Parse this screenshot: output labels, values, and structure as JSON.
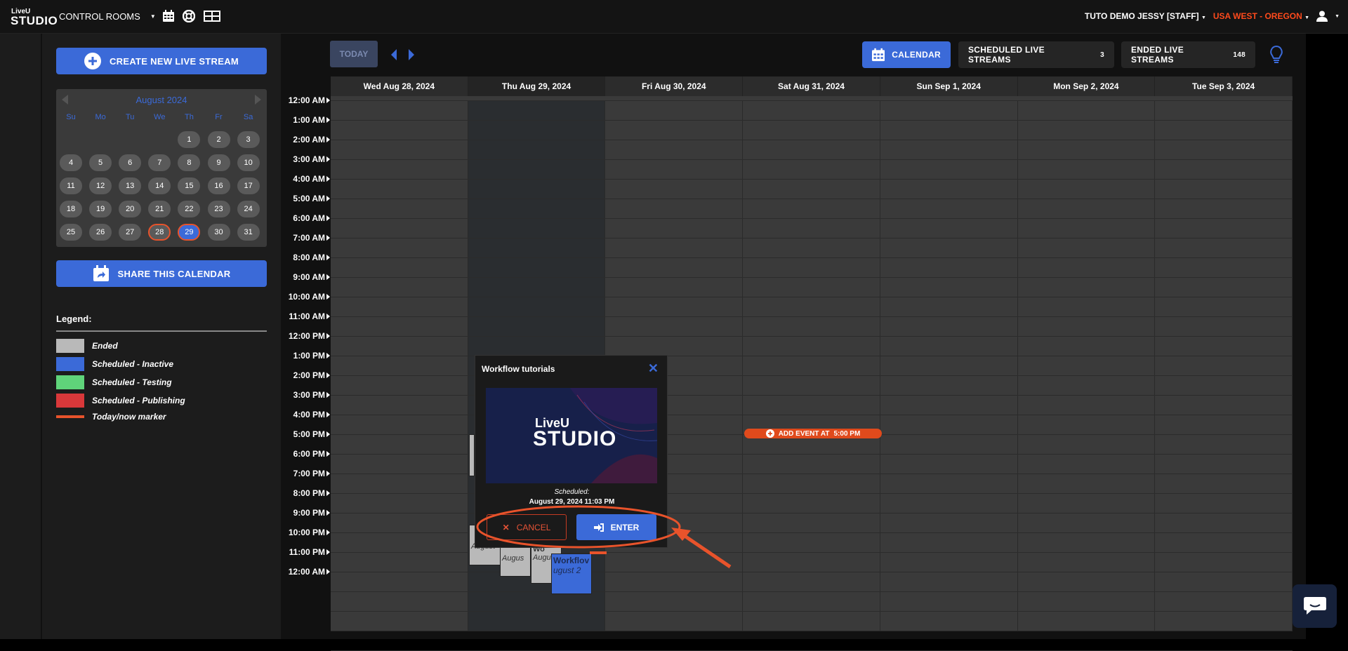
{
  "app": {
    "logo_top": "LiveU",
    "logo_bottom": "STUDIO"
  },
  "topbar": {
    "menu_label": "CONTROL ROOMS",
    "icons": [
      "calendar-icon",
      "lifebuoy-icon",
      "layout-icon"
    ],
    "user": "TUTO DEMO JESSY [STAFF]",
    "region": "USA WEST - OREGON",
    "colors": {
      "accent": "#3b6ad8",
      "region": "#ff4a1c"
    }
  },
  "sidebar": {
    "create_label": "CREATE NEW LIVE STREAM",
    "share_label": "SHARE THIS CALENDAR",
    "minical": {
      "month": "August 2024",
      "dows": [
        "Su",
        "Mo",
        "Tu",
        "We",
        "Th",
        "Fr",
        "Sa"
      ],
      "weeks": [
        [
          "",
          "",
          "",
          "",
          "1",
          "2",
          "3"
        ],
        [
          "4",
          "5",
          "6",
          "7",
          "8",
          "9",
          "10"
        ],
        [
          "11",
          "12",
          "13",
          "14",
          "15",
          "16",
          "17"
        ],
        [
          "18",
          "19",
          "20",
          "21",
          "22",
          "23",
          "24"
        ],
        [
          "25",
          "26",
          "27",
          "28",
          "29",
          "30",
          "31"
        ]
      ],
      "selected": "29",
      "marked": "28"
    },
    "legend": {
      "title": "Legend:",
      "items": [
        {
          "label": "Ended",
          "color": "#b9b9b9"
        },
        {
          "label": "Scheduled - Inactive",
          "color": "#3b6ad8"
        },
        {
          "label": "Scheduled - Testing",
          "color": "#5fd47a"
        },
        {
          "label": "Scheduled - Publishing",
          "color": "#d9383a"
        },
        {
          "label": "Today/now marker",
          "color": "#e8532b"
        }
      ]
    }
  },
  "toolbar": {
    "today_label": "TODAY",
    "calendar_label": "CALENDAR",
    "scheduled_label": "SCHEDULED LIVE STREAMS",
    "scheduled_count": "3",
    "ended_label": "ENDED LIVE STREAMS",
    "ended_count": "148"
  },
  "calendar": {
    "days": [
      "Wed Aug 28, 2024",
      "Thu Aug 29, 2024",
      "Fri Aug 30, 2024",
      "Sat Aug 31, 2024",
      "Sun Sep 1, 2024",
      "Mon Sep 2, 2024",
      "Tue Sep 3, 2024"
    ],
    "current_day_index": 1,
    "times": [
      "12:00 AM",
      "1:00 AM",
      "2:00 AM",
      "3:00 AM",
      "4:00 AM",
      "5:00 AM",
      "6:00 AM",
      "7:00 AM",
      "8:00 AM",
      "9:00 AM",
      "10:00 AM",
      "11:00 AM",
      "12:00 PM",
      "1:00 PM",
      "2:00 PM",
      "3:00 PM",
      "4:00 PM",
      "5:00 PM",
      "6:00 PM",
      "7:00 PM",
      "8:00 PM",
      "9:00 PM",
      "10:00 PM",
      "11:00 PM",
      "12:00 AM"
    ],
    "add_event_label": "ADD EVENT AT",
    "add_event_time": "5:00 PM"
  },
  "events": [
    {
      "title": "",
      "subtitle": "August",
      "color": "#b9b9b9"
    },
    {
      "title": "",
      "subtitle": "Augus",
      "color": "#b9b9b9"
    },
    {
      "title": "Wo",
      "subtitle": "Augus",
      "color": "#b9b9b9"
    },
    {
      "title": "Workflov",
      "subtitle": "ugust 2",
      "color": "#3b6ad8"
    }
  ],
  "popup": {
    "title": "Workflow tutorials",
    "thumb_top": "LiveU",
    "thumb_bottom": "STUDIO",
    "scheduled_label": "Scheduled:",
    "scheduled_date": "August 29, 2024 11:03 PM",
    "cancel_label": "CANCEL",
    "enter_label": "ENTER"
  }
}
